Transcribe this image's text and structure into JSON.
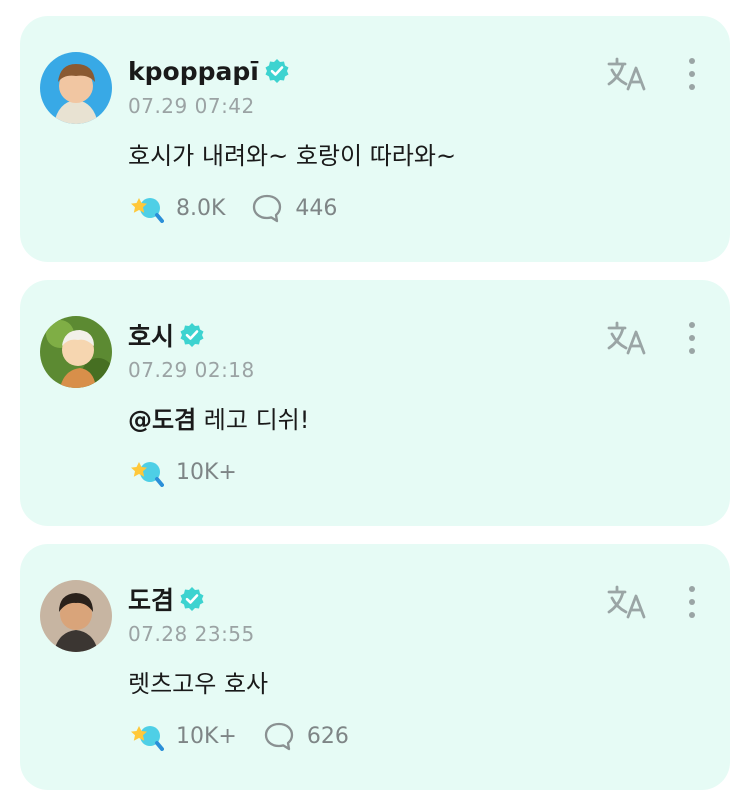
{
  "colors": {
    "card_bg": "#e6fbf5",
    "verified": "#3dd3d0",
    "icon_grey": "#9aa5a5",
    "text": "#1a1a1a",
    "muted": "#9ba3a4"
  },
  "posts": [
    {
      "author": "kpoppapī",
      "date": "07.29 07:42",
      "content": "호시가 내려와~ 호랑이 따라와~",
      "likes": "8.0K",
      "comments": "446"
    },
    {
      "author": "호시",
      "date": "07.29 02:18",
      "mention": "@도겸",
      "content": " 레고 디쉬!",
      "likes": "10K+"
    },
    {
      "author": "도겸",
      "date": "07.28 23:55",
      "content": "렛츠고우 호사",
      "likes": "10K+",
      "comments": "626"
    }
  ]
}
